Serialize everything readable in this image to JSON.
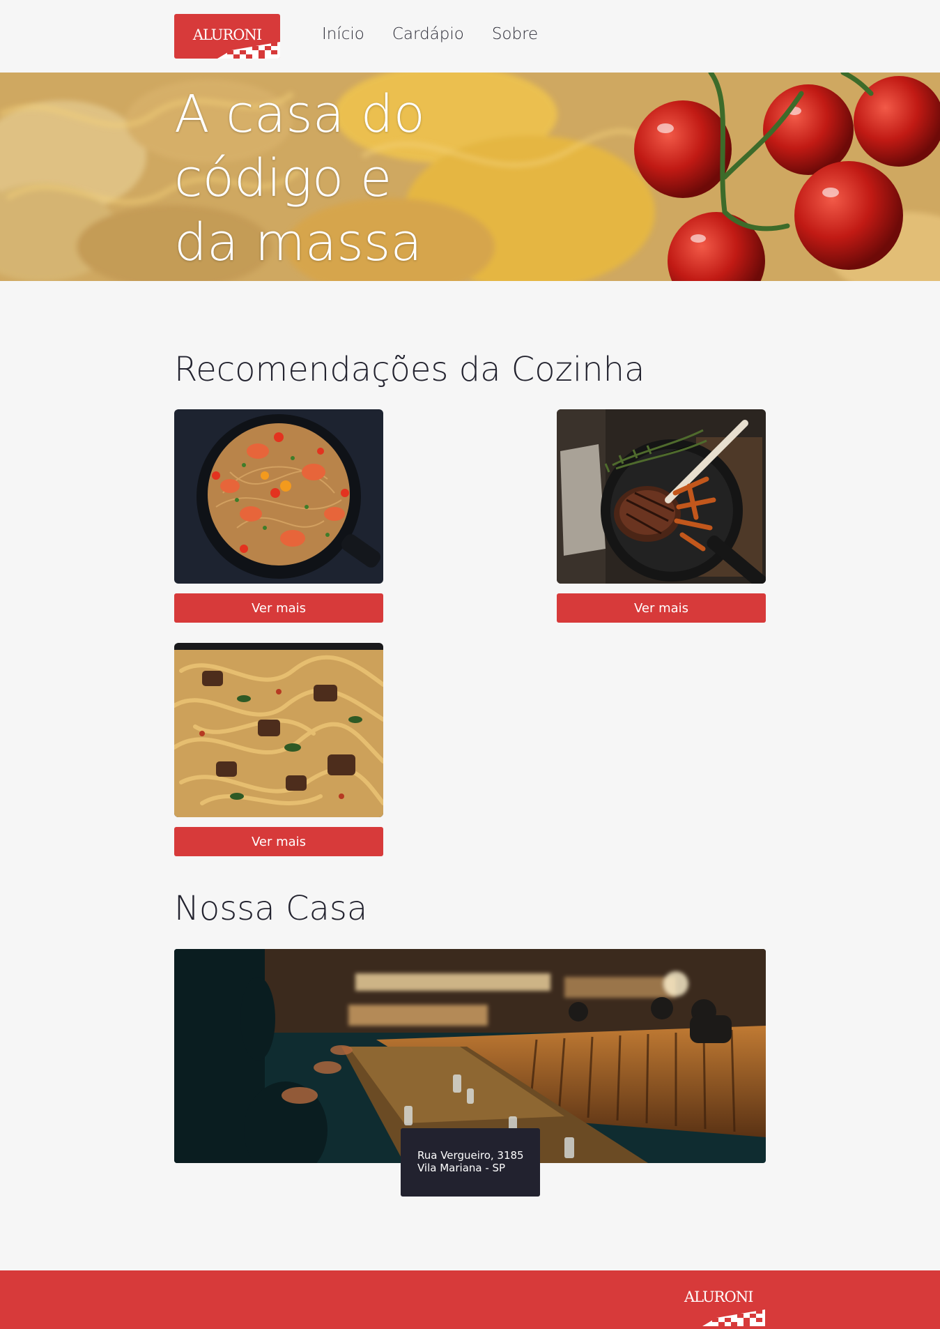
{
  "brand": {
    "name": "ALURONI",
    "color": "#d73a3a"
  },
  "nav": {
    "items": [
      "Início",
      "Cardápio",
      "Sobre"
    ]
  },
  "hero": {
    "title": "A casa do código e da massa"
  },
  "recommendations": {
    "title": "Recomendações da Cozinha",
    "cards": [
      {
        "image": "shrimp-spaghetti-pan-photo",
        "button": "Ver mais"
      },
      {
        "image": "steak-with-fries-skillet-photo",
        "button": "Ver mais"
      },
      {
        "image": "fettuccine-with-meat-photo",
        "button": "Ver mais"
      }
    ]
  },
  "house": {
    "title": "Nossa Casa",
    "image": "restaurant-interior-photo",
    "address_line1": "Rua Vergueiro, 3185",
    "address_line2": "Vila Mariana - SP"
  },
  "colors": {
    "background": "#f6f6f6",
    "text": "#23232f",
    "address_bg": "#22222f"
  }
}
